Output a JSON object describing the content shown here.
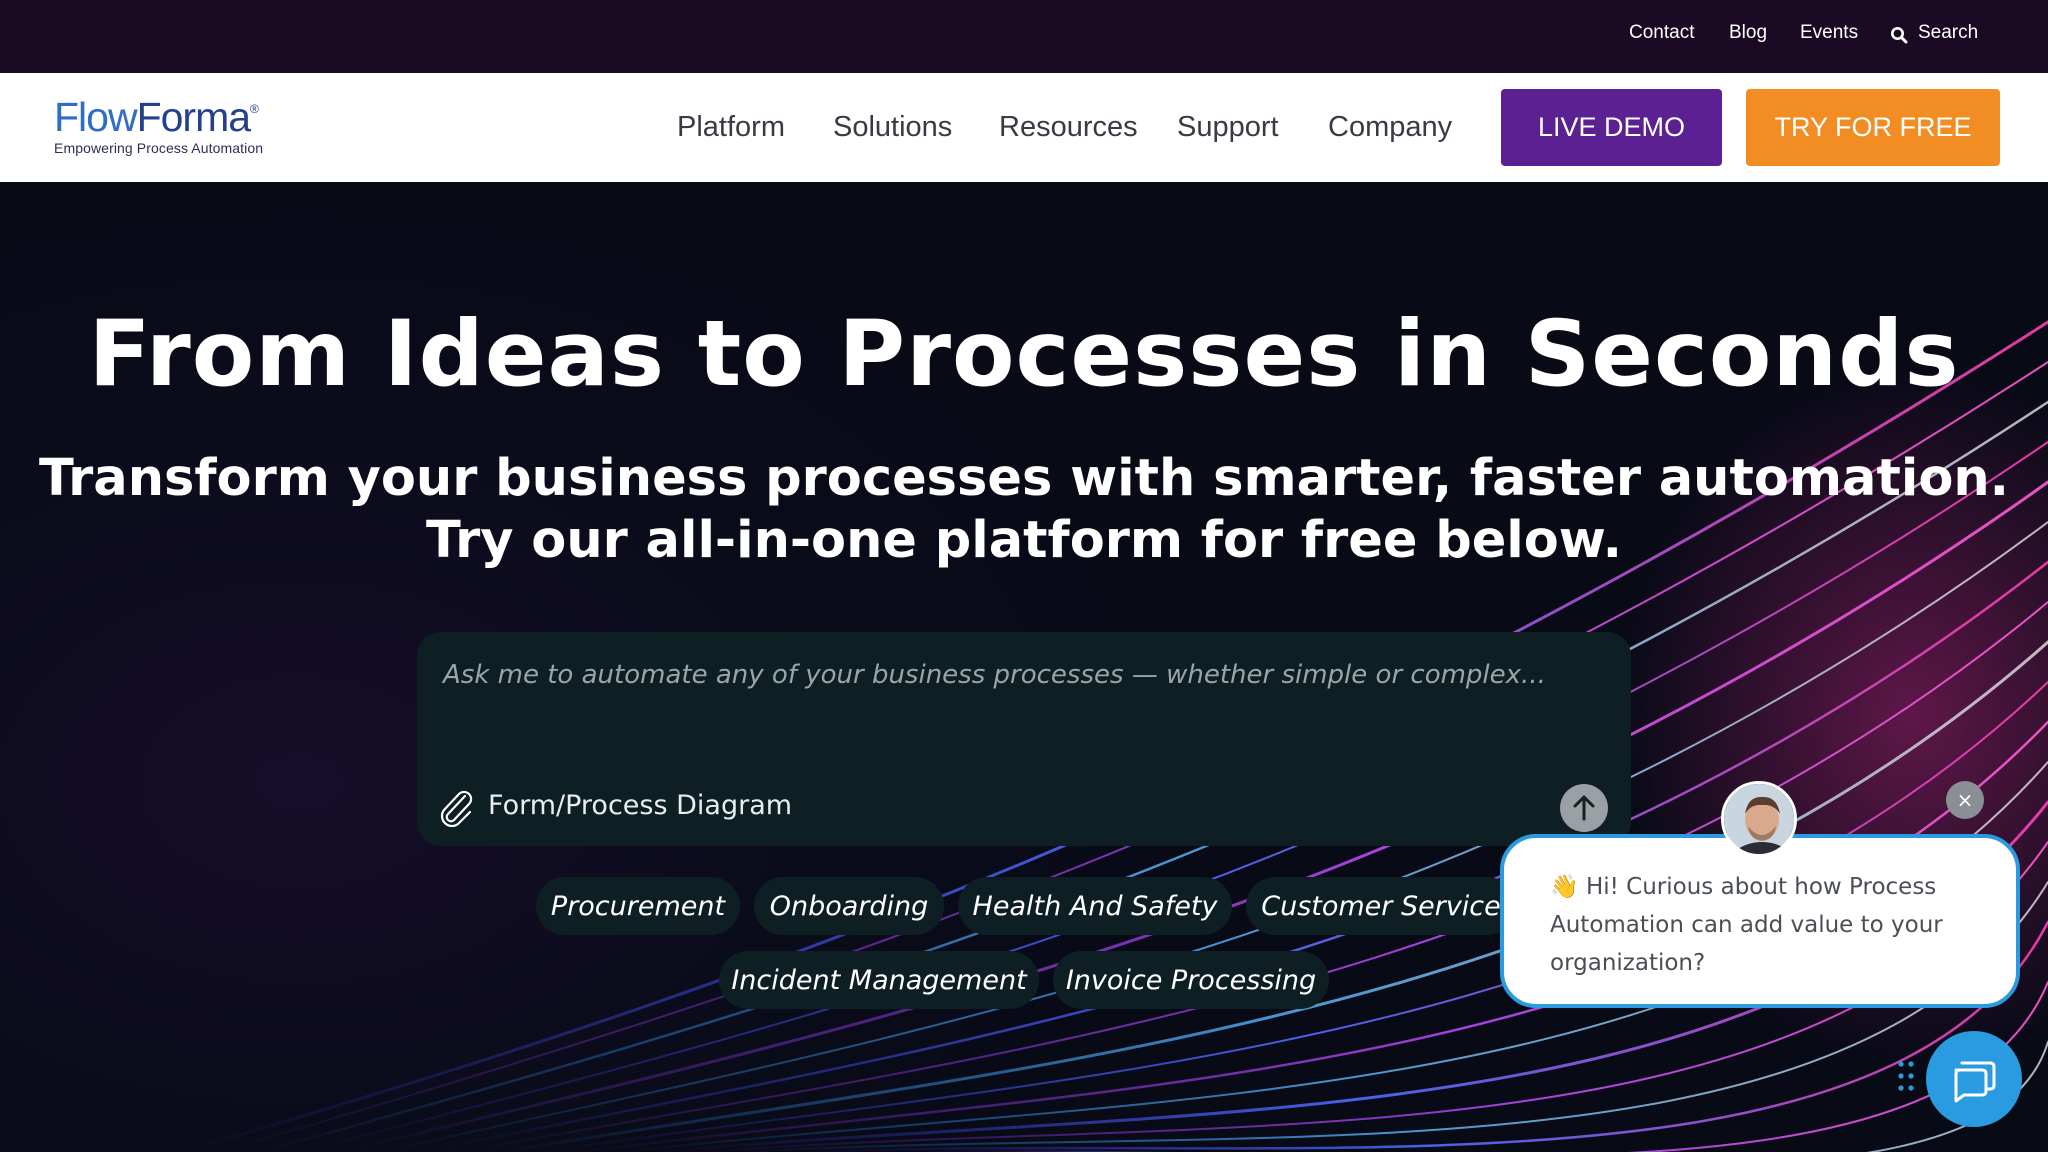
{
  "utility_bar": {
    "links": [
      "Contact",
      "Blog",
      "Events"
    ],
    "search_label": "Search"
  },
  "navbar": {
    "logo": {
      "word_flow": "Flow",
      "word_forma": "Forma",
      "registered": "®",
      "tagline": "Empowering Process Automation"
    },
    "items": [
      "Platform",
      "Solutions",
      "Resources",
      "Support",
      "Company"
    ],
    "demo_button": "LIVE DEMO",
    "free_button": "TRY FOR FREE"
  },
  "hero": {
    "title": "From Ideas to Processes in Seconds",
    "subtitle_line1": "Transform your business processes with smarter, faster automation.",
    "subtitle_line2": "Try our all-in-one platform for free below.",
    "prompt": {
      "placeholder": "Ask me to automate any of your business processes — whether simple or complex...",
      "attach_label": "Form/Process Diagram"
    },
    "chips_row1": [
      "Procurement",
      "Onboarding",
      "Health And Safety",
      "Customer Service"
    ],
    "chips_row2": [
      "Incident Management",
      "Invoice Processing"
    ]
  },
  "chat_widget": {
    "emoji": "👋",
    "message": "Hi! Curious about how Process Automation can add value to your organization?",
    "close_symbol": "×"
  },
  "colors": {
    "utility_bg": "#1a0a24",
    "demo_button": "#5b2192",
    "free_button": "#f18d23",
    "prompt_bg": "#0e1f24",
    "chat_accent": "#2a9be0"
  },
  "icons": [
    "search-icon",
    "paperclip-icon",
    "arrow-up-icon",
    "close-icon",
    "chat-icon",
    "drag-dots-icon"
  ]
}
